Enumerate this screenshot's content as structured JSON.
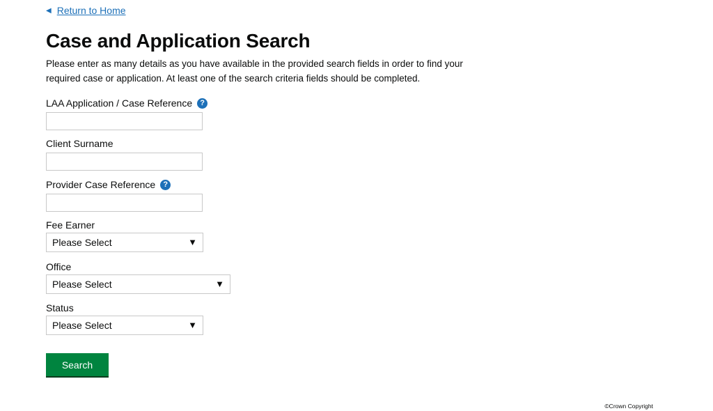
{
  "nav": {
    "back_arrow": "◀",
    "back_label": "Return to Home"
  },
  "header": {
    "title": "Case and Application Search",
    "intro": "Please enter as many details as you have available in the provided search fields in order to find your required case or application. At least one of the search criteria fields should be completed."
  },
  "form": {
    "help_glyph": "?",
    "laa_reference": {
      "label": "LAA Application / Case Reference",
      "value": "",
      "has_help": true
    },
    "client_surname": {
      "label": "Client Surname",
      "value": ""
    },
    "provider_reference": {
      "label": "Provider Case Reference",
      "value": "",
      "has_help": true
    },
    "fee_earner": {
      "label": "Fee Earner",
      "selected": "Please Select"
    },
    "office": {
      "label": "Office",
      "selected": "Please Select"
    },
    "status": {
      "label": "Status",
      "selected": "Please Select"
    },
    "caret_glyph": "▼",
    "search_label": "Search"
  },
  "footer": {
    "copyright": "©Crown Copyright"
  },
  "colors": {
    "link": "#1d70b8",
    "help_icon": "#1d70b8",
    "search_button": "#00843f"
  }
}
